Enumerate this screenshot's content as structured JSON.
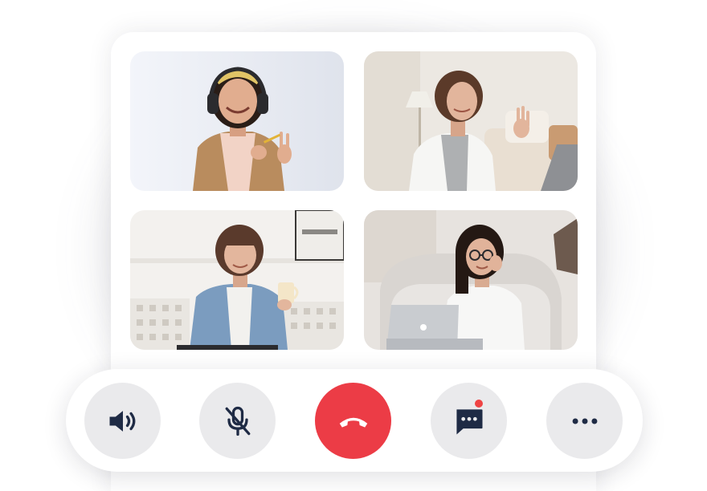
{
  "participants": [
    {
      "icon": "participant-video-headphones-woman"
    },
    {
      "icon": "participant-video-couch-woman"
    },
    {
      "icon": "participant-video-mug-woman"
    },
    {
      "icon": "participant-video-laptop-woman"
    }
  ],
  "controls": [
    {
      "id": "speaker",
      "icon": "speaker-icon"
    },
    {
      "id": "mute",
      "icon": "mic-off-icon"
    },
    {
      "id": "end-call",
      "icon": "phone-hangup-icon"
    },
    {
      "id": "chat",
      "icon": "chat-icon",
      "has_notification": true
    },
    {
      "id": "more",
      "icon": "more-icon"
    }
  ],
  "colors": {
    "control_bg": "#eaeaec",
    "end_call": "#ec3c46",
    "icon": "#1f2b45",
    "notification": "#ef4444"
  }
}
